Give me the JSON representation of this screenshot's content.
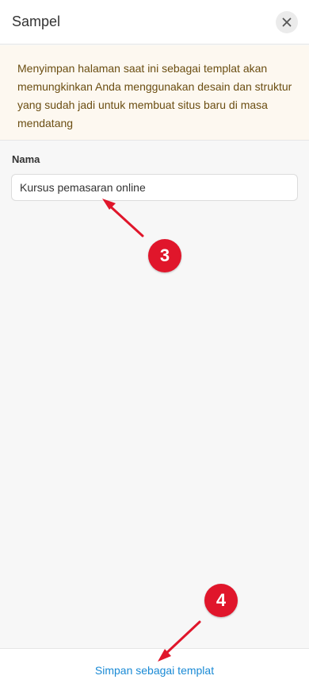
{
  "header": {
    "title": "Sampel",
    "close_icon": "close-icon"
  },
  "notice": {
    "text": "Menyimpan halaman saat ini sebagai templat akan memungkinkan Anda menggunakan desain dan struktur yang sudah jadi untuk membuat situs baru di masa mendatang",
    "text_color": "#6b4e12",
    "background": "#fdf8f0"
  },
  "form": {
    "name_label": "Nama",
    "name_value": "Kursus pemasaran online"
  },
  "footer": {
    "save_label": "Simpan sebagai templat",
    "link_color": "#1a8ad5"
  },
  "annotations": {
    "step_3": "3",
    "step_4": "4",
    "badge_color": "#e0162b"
  }
}
